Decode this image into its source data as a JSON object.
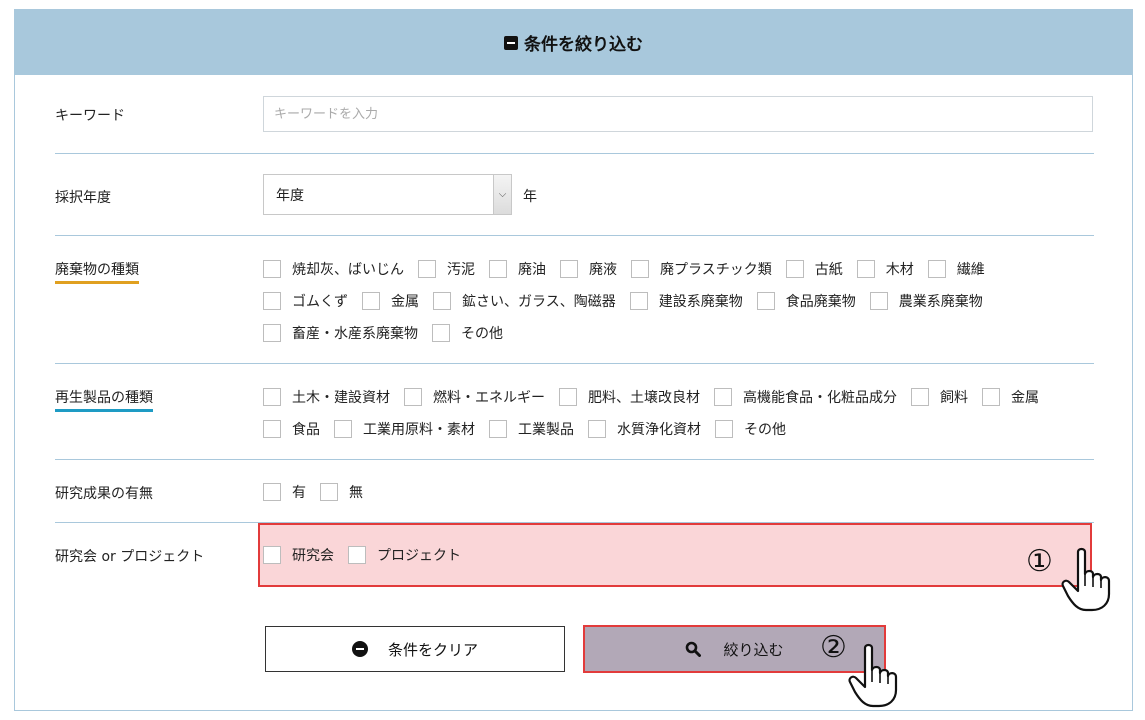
{
  "header": {
    "title": "条件を絞り込む",
    "icon": "minus-square-icon"
  },
  "keyword": {
    "label": "キーワード",
    "placeholder": "キーワードを入力",
    "value": ""
  },
  "year": {
    "label": "採択年度",
    "selected": "年度",
    "unit": "年"
  },
  "waste_types": {
    "label": "廃棄物の種類",
    "accent": "#e0a020",
    "rows": [
      [
        "焼却灰、ばいじん",
        "汚泥",
        "廃油",
        "廃液",
        "廃プラスチック類",
        "古紙",
        "木材",
        "繊維"
      ],
      [
        "ゴムくず",
        "金属",
        "鉱さい、ガラス、陶磁器",
        "建設系廃棄物",
        "食品廃棄物",
        "農業系廃棄物"
      ],
      [
        "畜産・水産系廃棄物",
        "その他"
      ]
    ]
  },
  "recycled_types": {
    "label": "再生製品の種類",
    "accent": "#1e9bc4",
    "rows": [
      [
        "土木・建設資材",
        "燃料・エネルギー",
        "肥料、土壌改良材",
        "高機能食品・化粧品成分",
        "飼料",
        "金属"
      ],
      [
        "食品",
        "工業用原料・素材",
        "工業製品",
        "水質浄化資材",
        "その他"
      ]
    ]
  },
  "results": {
    "label": "研究成果の有無",
    "options": [
      "有",
      "無"
    ]
  },
  "project": {
    "label": "研究会 or プロジェクト",
    "options": [
      "研究会",
      "プロジェクト"
    ],
    "highlight_color": "#e23b3b"
  },
  "annotations": {
    "step1": "①",
    "step2": "②"
  },
  "buttons": {
    "clear": "条件をクリア",
    "search": "絞り込む"
  }
}
